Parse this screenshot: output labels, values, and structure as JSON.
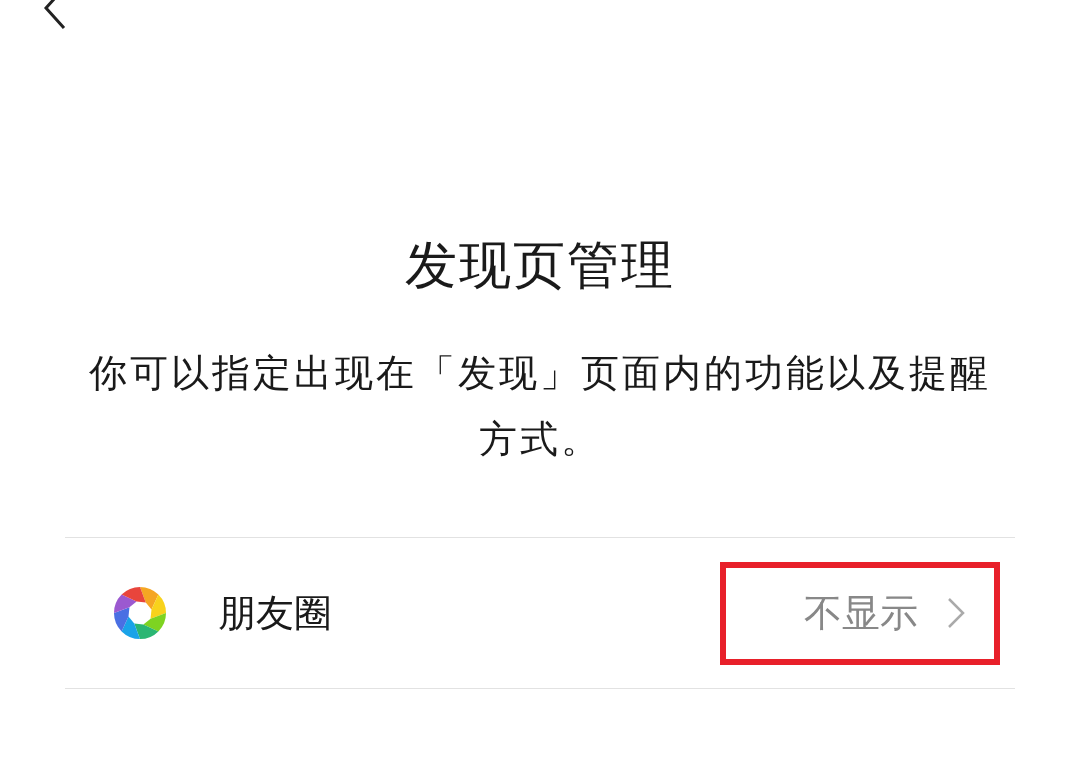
{
  "title": "发现页管理",
  "description": "你可以指定出现在「发现」页面内的功能以及提醒方式。",
  "items": [
    {
      "label": "朋友圈",
      "value": "不显示",
      "highlighted": true
    }
  ]
}
